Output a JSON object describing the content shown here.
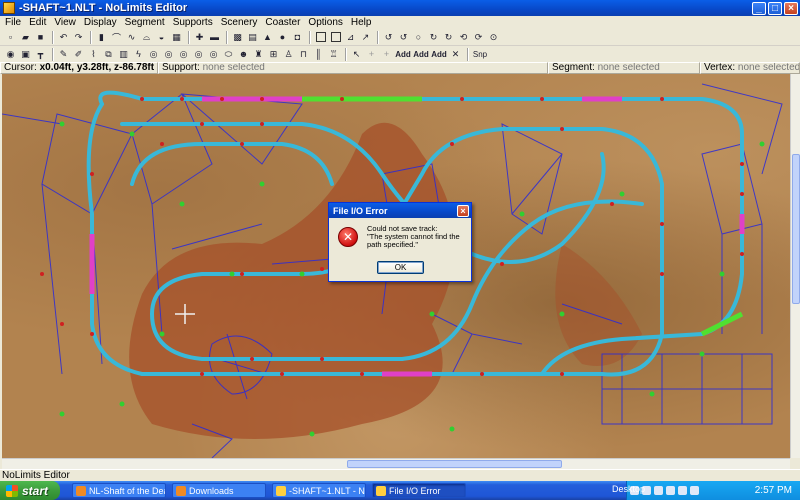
{
  "window": {
    "title": "-SHAFT~1.NLT - NoLimits Editor"
  },
  "menu": [
    "File",
    "Edit",
    "View",
    "Display",
    "Segment",
    "Supports",
    "Scenery",
    "Coaster",
    "Options",
    "Help"
  ],
  "status": {
    "cursor_label": "Cursor:",
    "cursor_value": "x0.04ft, y3.28ft, z-86.78ft",
    "support_label": "Support:",
    "support_value": "none selected",
    "segment_label": "Segment:",
    "segment_value": "none selected",
    "vertex_label": "Vertex:",
    "vertex_value": "none selected"
  },
  "toolbar": {
    "add_label": "Add",
    "snp_label": "Snp"
  },
  "dialog": {
    "title": "File I/O Error",
    "message_line1": "Could not save track:",
    "message_line2": "\"The system cannot find the path specified.\"",
    "ok_label": "OK"
  },
  "app_status": "NoLimits Editor",
  "taskbar": {
    "start_label": "start",
    "tasks": [
      {
        "label": "NL-Shaft of the Dead..."
      },
      {
        "label": "Downloads"
      },
      {
        "label": "-SHAFT~1.NLT - NoLi..."
      },
      {
        "label": "File I/O Error"
      }
    ],
    "desktop_label": "Desktop",
    "clock": "2:57 PM"
  },
  "colors": {
    "track": "#39b8d8",
    "supports": "#2a2ad8",
    "highlight_track": "#e040c8",
    "selected_track": "#50e030",
    "terrain": "#b2834f"
  }
}
